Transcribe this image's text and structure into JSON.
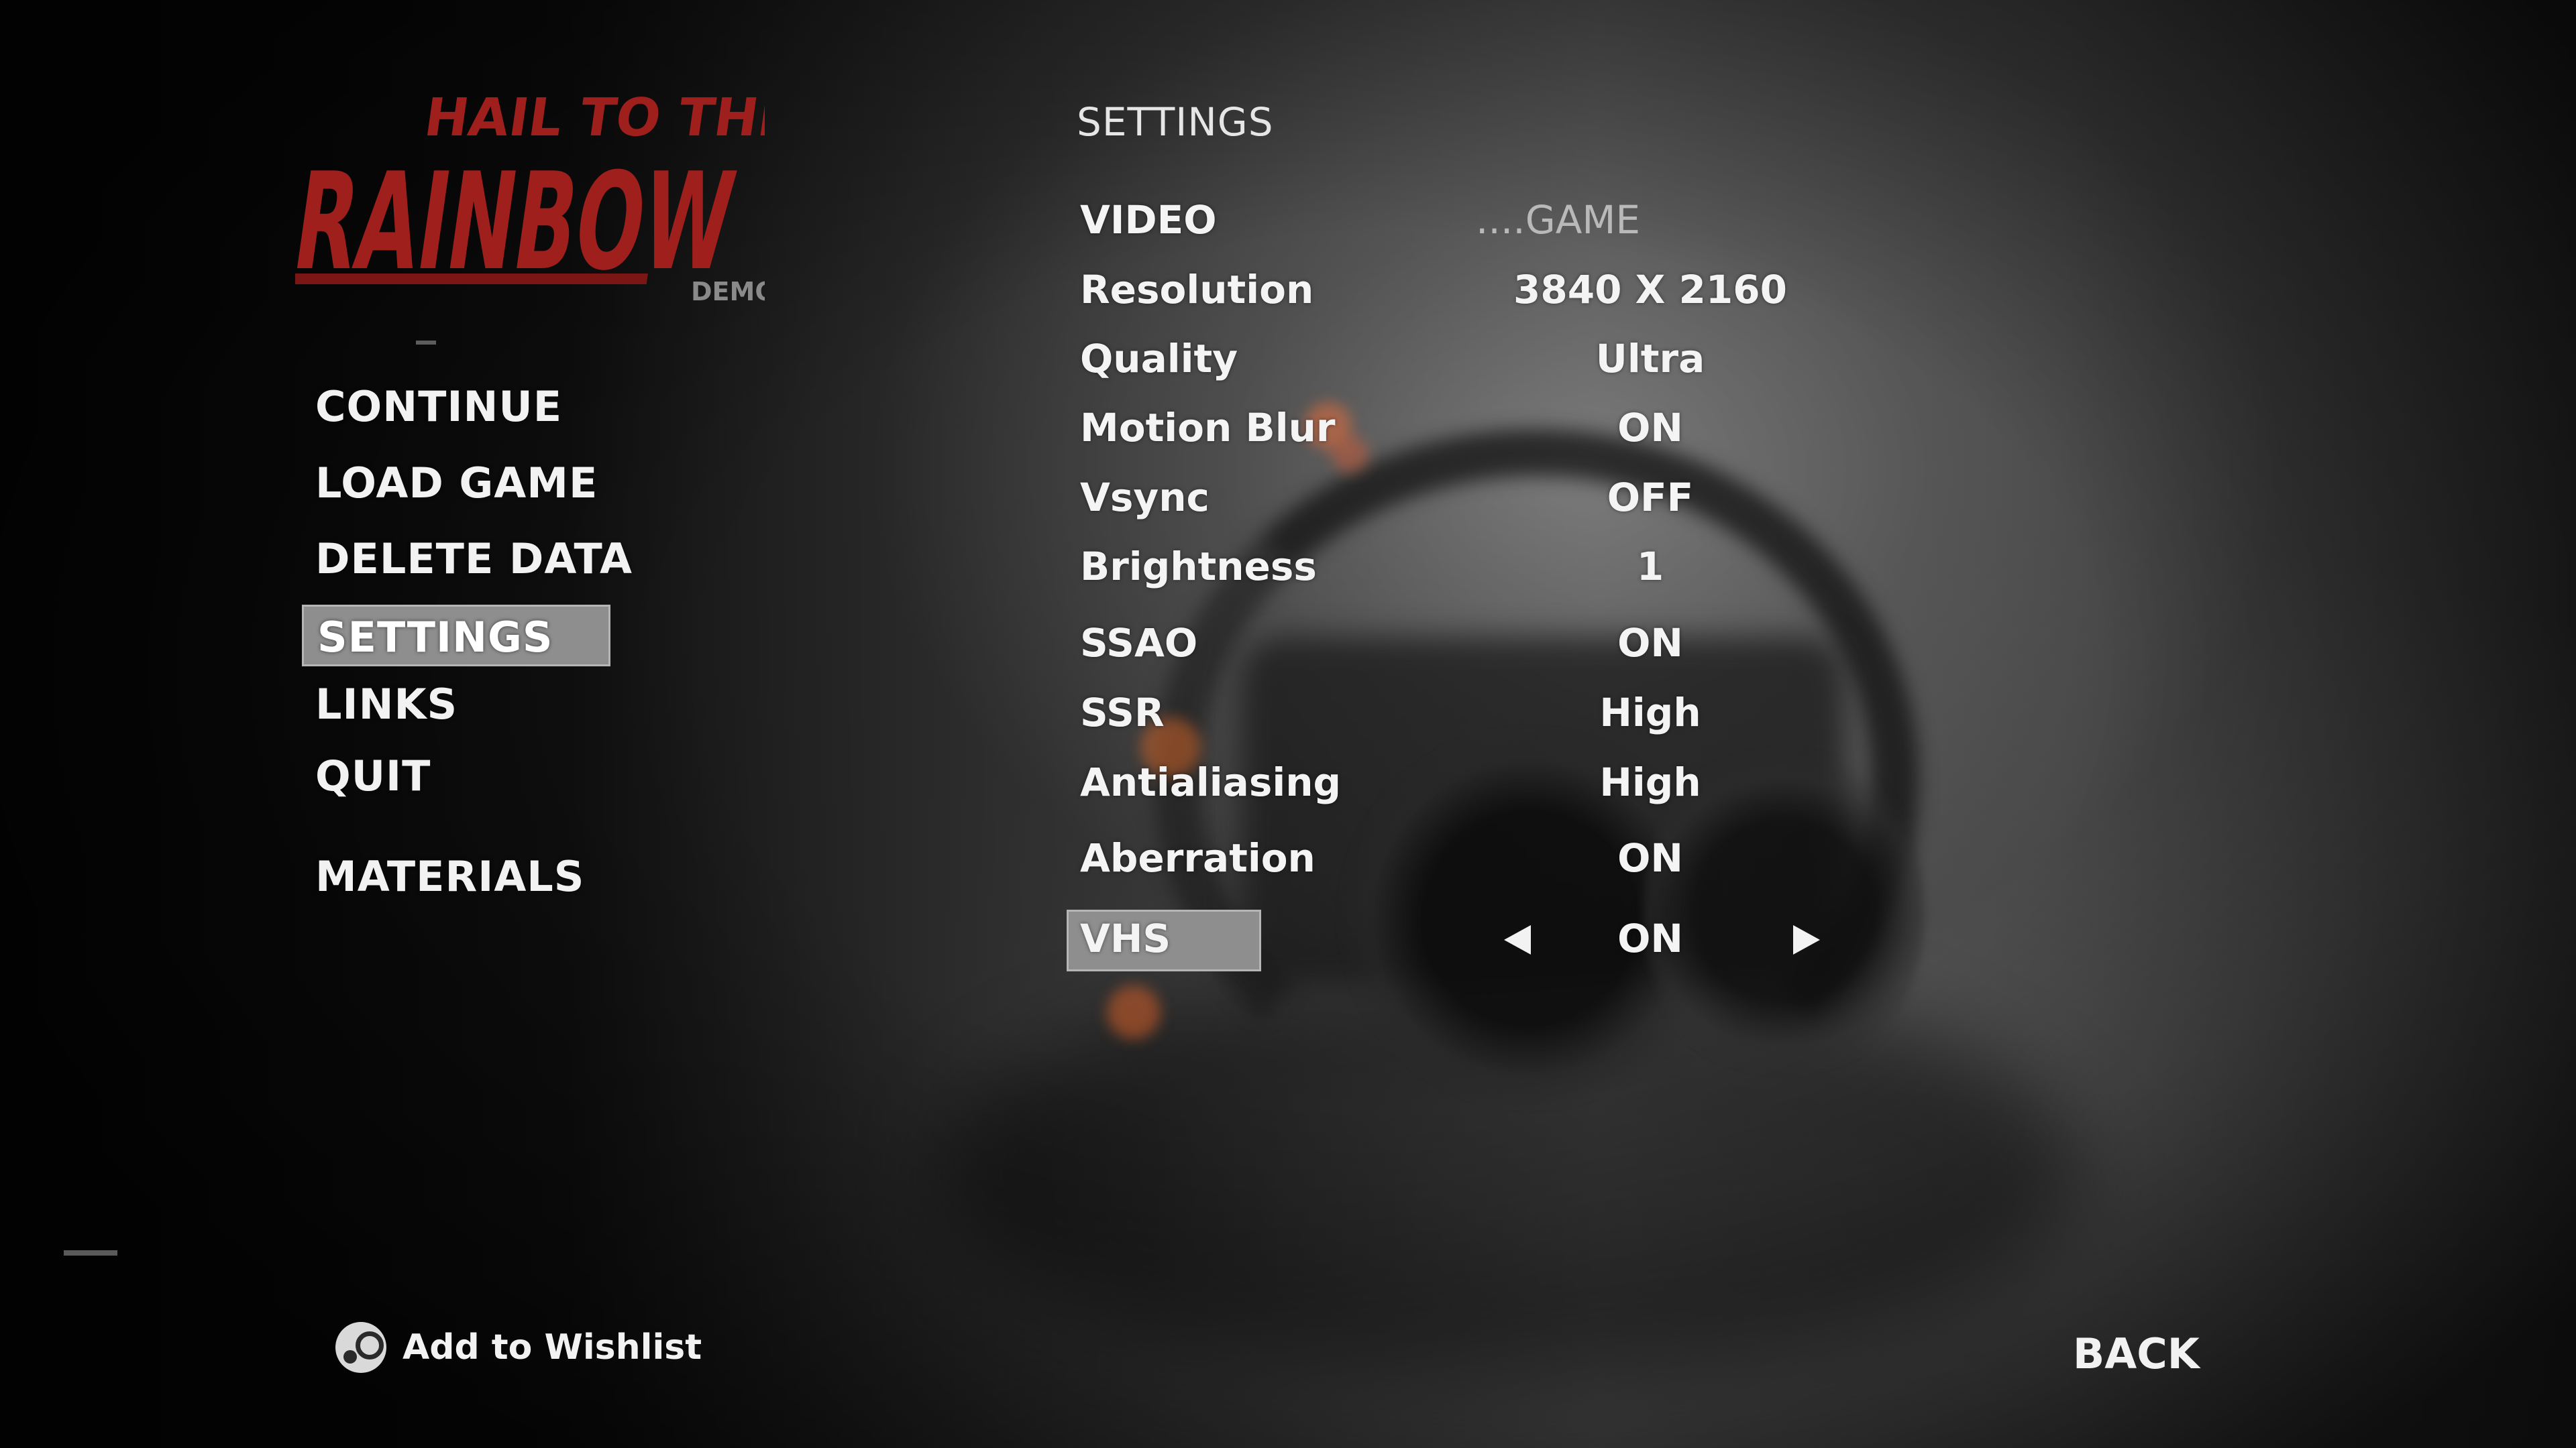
{
  "logo": {
    "line1": "HAIL TO THE",
    "line2": "RAINBOW",
    "badge": "DEMO"
  },
  "main_menu": {
    "items": [
      {
        "label": "CONTINUE"
      },
      {
        "label": "LOAD GAME"
      },
      {
        "label": "DELETE DATA"
      },
      {
        "label": "SETTINGS",
        "selected": true
      },
      {
        "label": "LINKS"
      },
      {
        "label": "QUIT"
      },
      {
        "label": "MATERIALS"
      }
    ]
  },
  "settings": {
    "title": "SETTINGS",
    "tabs": {
      "video": "VIDEO",
      "game": "....GAME",
      "active": "VIDEO"
    },
    "rows": [
      {
        "label": "Resolution",
        "value": "3840 X 2160"
      },
      {
        "label": "Quality",
        "value": "Ultra"
      },
      {
        "label": "Motion Blur",
        "value": "ON"
      },
      {
        "label": "Vsync",
        "value": "OFF"
      },
      {
        "label": "Brightness",
        "value": "1"
      },
      {
        "label": "SSAO",
        "value": "ON"
      },
      {
        "label": "SSR",
        "value": "High"
      },
      {
        "label": "Antialiasing",
        "value": "High"
      },
      {
        "label": "Aberration",
        "value": "ON"
      },
      {
        "label": "VHS",
        "value": "ON",
        "selected": true
      }
    ]
  },
  "footer": {
    "wishlist_label": "Add to Wishlist",
    "wishlist_icon": "steam-icon",
    "back_label": "BACK"
  },
  "colors": {
    "logo_red": "#9e1f1c",
    "highlight": "#8e8e8e",
    "text": "#f2f2f2"
  }
}
